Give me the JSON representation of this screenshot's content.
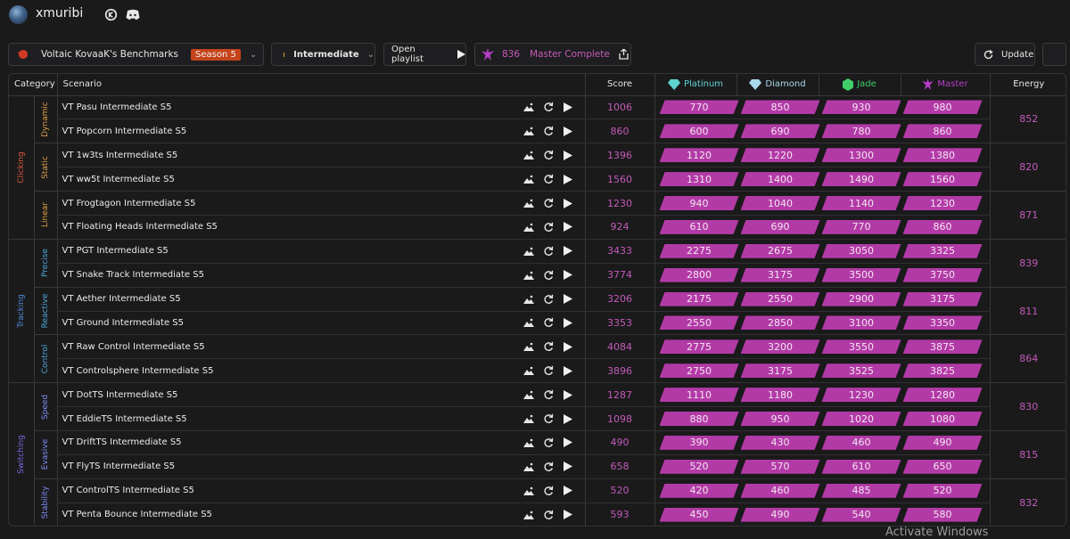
{
  "user": {
    "name": "xmuribi"
  },
  "toolbar": {
    "benchmark": "Voltaic KovaaK's Benchmarks",
    "season": "Season 5",
    "difficulty": "Intermediate",
    "open_playlist": "Open playlist",
    "energy_total": "836",
    "rank_status": "Master Complete",
    "update": "Update"
  },
  "headers": {
    "category": "Category",
    "scenario": "Scenario",
    "score": "Score",
    "ranks": [
      "Platinum",
      "Diamond",
      "Jade",
      "Master"
    ],
    "energy": "Energy"
  },
  "colors": {
    "clicking": "#e05a3f",
    "clicking_sub": "#e0a040",
    "tracking": "#4f8cd9",
    "tracking_sub": "#4fa7d9",
    "switching": "#7b6ae0",
    "switching_sub": "#7f8cf0",
    "platinum": "#5fd3d0",
    "diamond": "#a8d8ea",
    "jade": "#3fce6a",
    "master": "#b43ec5"
  },
  "categories": [
    {
      "name": "Clicking",
      "subs": [
        {
          "name": "Dynamic",
          "energy": "852",
          "rows": [
            {
              "scenario": "VT Pasu Intermediate S5",
              "score": "1006",
              "t": [
                "770",
                "850",
                "930",
                "980"
              ]
            },
            {
              "scenario": "VT Popcorn Intermediate S5",
              "score": "860",
              "t": [
                "600",
                "690",
                "780",
                "860"
              ]
            }
          ]
        },
        {
          "name": "Static",
          "energy": "820",
          "rows": [
            {
              "scenario": "VT 1w3ts Intermediate S5",
              "score": "1396",
              "t": [
                "1120",
                "1220",
                "1300",
                "1380"
              ]
            },
            {
              "scenario": "VT ww5t Intermediate S5",
              "score": "1560",
              "t": [
                "1310",
                "1400",
                "1490",
                "1560"
              ]
            }
          ]
        },
        {
          "name": "Linear",
          "energy": "871",
          "rows": [
            {
              "scenario": "VT Frogtagon Intermediate S5",
              "score": "1230",
              "t": [
                "940",
                "1040",
                "1140",
                "1230"
              ]
            },
            {
              "scenario": "VT Floating Heads Intermediate S5",
              "score": "924",
              "t": [
                "610",
                "690",
                "770",
                "860"
              ]
            }
          ]
        }
      ]
    },
    {
      "name": "Tracking",
      "subs": [
        {
          "name": "Precise",
          "energy": "839",
          "rows": [
            {
              "scenario": "VT PGT Intermediate S5",
              "score": "3433",
              "t": [
                "2275",
                "2675",
                "3050",
                "3325"
              ]
            },
            {
              "scenario": "VT Snake Track Intermediate S5",
              "score": "3774",
              "t": [
                "2800",
                "3175",
                "3500",
                "3750"
              ]
            }
          ]
        },
        {
          "name": "Reactive",
          "energy": "811",
          "rows": [
            {
              "scenario": "VT Aether Intermediate S5",
              "score": "3206",
              "t": [
                "2175",
                "2550",
                "2900",
                "3175"
              ]
            },
            {
              "scenario": "VT Ground Intermediate S5",
              "score": "3353",
              "t": [
                "2550",
                "2850",
                "3100",
                "3350"
              ]
            }
          ]
        },
        {
          "name": "Control",
          "energy": "864",
          "rows": [
            {
              "scenario": "VT Raw Control Intermediate S5",
              "score": "4084",
              "t": [
                "2775",
                "3200",
                "3550",
                "3875"
              ]
            },
            {
              "scenario": "VT Controlsphere Intermediate S5",
              "score": "3896",
              "t": [
                "2750",
                "3175",
                "3525",
                "3825"
              ]
            }
          ]
        }
      ]
    },
    {
      "name": "Switching",
      "subs": [
        {
          "name": "Speed",
          "energy": "830",
          "rows": [
            {
              "scenario": "VT DotTS Intermediate S5",
              "score": "1287",
              "t": [
                "1110",
                "1180",
                "1230",
                "1280"
              ]
            },
            {
              "scenario": "VT EddieTS Intermediate S5",
              "score": "1098",
              "t": [
                "880",
                "950",
                "1020",
                "1080"
              ]
            }
          ]
        },
        {
          "name": "Evasive",
          "energy": "815",
          "rows": [
            {
              "scenario": "VT DriftTS Intermediate S5",
              "score": "490",
              "t": [
                "390",
                "430",
                "460",
                "490"
              ]
            },
            {
              "scenario": "VT FlyTS Intermediate S5",
              "score": "658",
              "t": [
                "520",
                "570",
                "610",
                "650"
              ]
            }
          ]
        },
        {
          "name": "Stability",
          "energy": "832",
          "rows": [
            {
              "scenario": "VT ControlTS Intermediate S5",
              "score": "520",
              "t": [
                "420",
                "460",
                "485",
                "520"
              ]
            },
            {
              "scenario": "VT Penta Bounce Intermediate S5",
              "score": "593",
              "t": [
                "450",
                "490",
                "540",
                "580"
              ]
            }
          ]
        }
      ]
    }
  ],
  "watermark": "Activate Windows"
}
